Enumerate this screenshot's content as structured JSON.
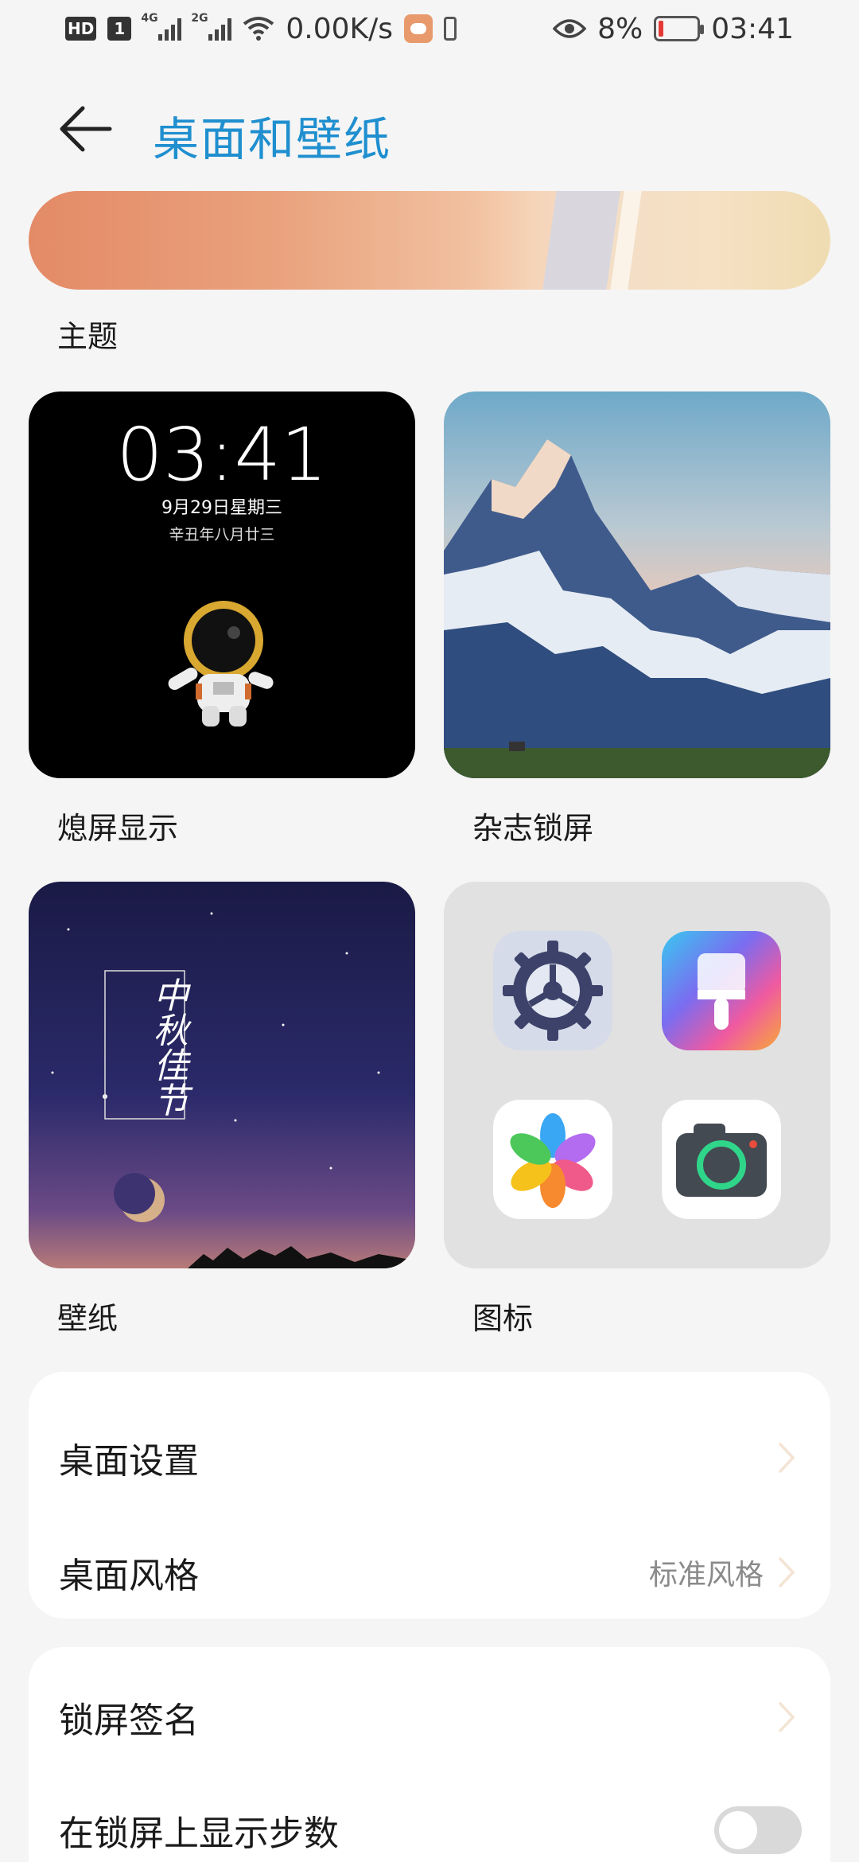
{
  "status_bar": {
    "hd_label": "HD",
    "sim_label": "1",
    "net1_label": "4G",
    "net2_label": "2G",
    "speed": "0.00K/s",
    "battery_percent": "8%",
    "time": "03:41"
  },
  "header": {
    "title": "桌面和壁纸"
  },
  "theme": {
    "label": "主题"
  },
  "tiles": {
    "aod": {
      "label": "熄屏显示",
      "time": "03:41",
      "date": "9月29日星期三",
      "lunar": "辛丑年八月廿三"
    },
    "magazine": {
      "label": "杂志锁屏"
    },
    "wallpaper": {
      "label": "壁纸",
      "calligraphy": "中秋佳节"
    },
    "icons": {
      "label": "图标",
      "apps": [
        "settings-icon",
        "theme-brush-icon",
        "gallery-icon",
        "camera-icon"
      ]
    }
  },
  "settings_group_1": {
    "rows": [
      {
        "label": "桌面设置",
        "value": ""
      },
      {
        "label": "桌面风格",
        "value": "标准风格"
      }
    ]
  },
  "settings_group_2": {
    "rows": [
      {
        "label": "锁屏签名"
      },
      {
        "label": "在锁屏上显示步数",
        "toggle": false
      }
    ]
  },
  "colors": {
    "accent": "#1f8fcf",
    "background": "#f5f5f5",
    "card": "#ffffff",
    "secondary_text": "#8a8a8a",
    "toggle_off": "#d9d9d9"
  }
}
